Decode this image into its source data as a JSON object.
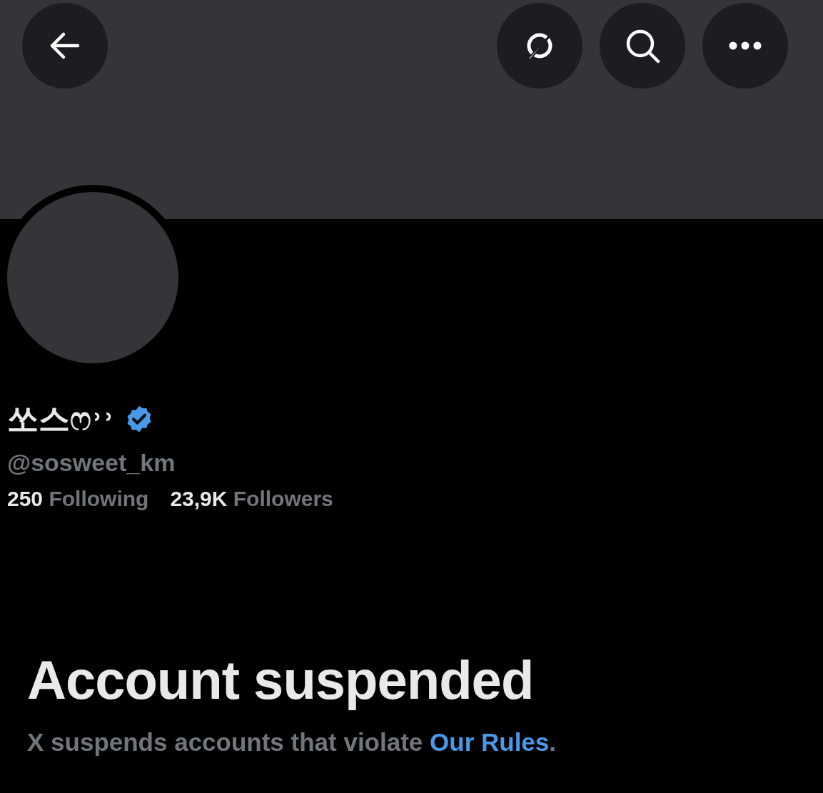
{
  "header": {
    "buttons": [
      {
        "kind": "back"
      },
      {
        "kind": "grok"
      },
      {
        "kind": "search"
      },
      {
        "kind": "more"
      }
    ]
  },
  "profile": {
    "display_name": "쏘스ෆ˒˒",
    "verified": true,
    "handle": "@sosweet_km",
    "stats": [
      {
        "count": "250",
        "label": "Following"
      },
      {
        "count": "23,9K",
        "label": "Followers"
      }
    ]
  },
  "notice": {
    "title": "Account suspended",
    "message": "X suspends accounts that violate ",
    "link": "Our Rules",
    "end": "."
  }
}
